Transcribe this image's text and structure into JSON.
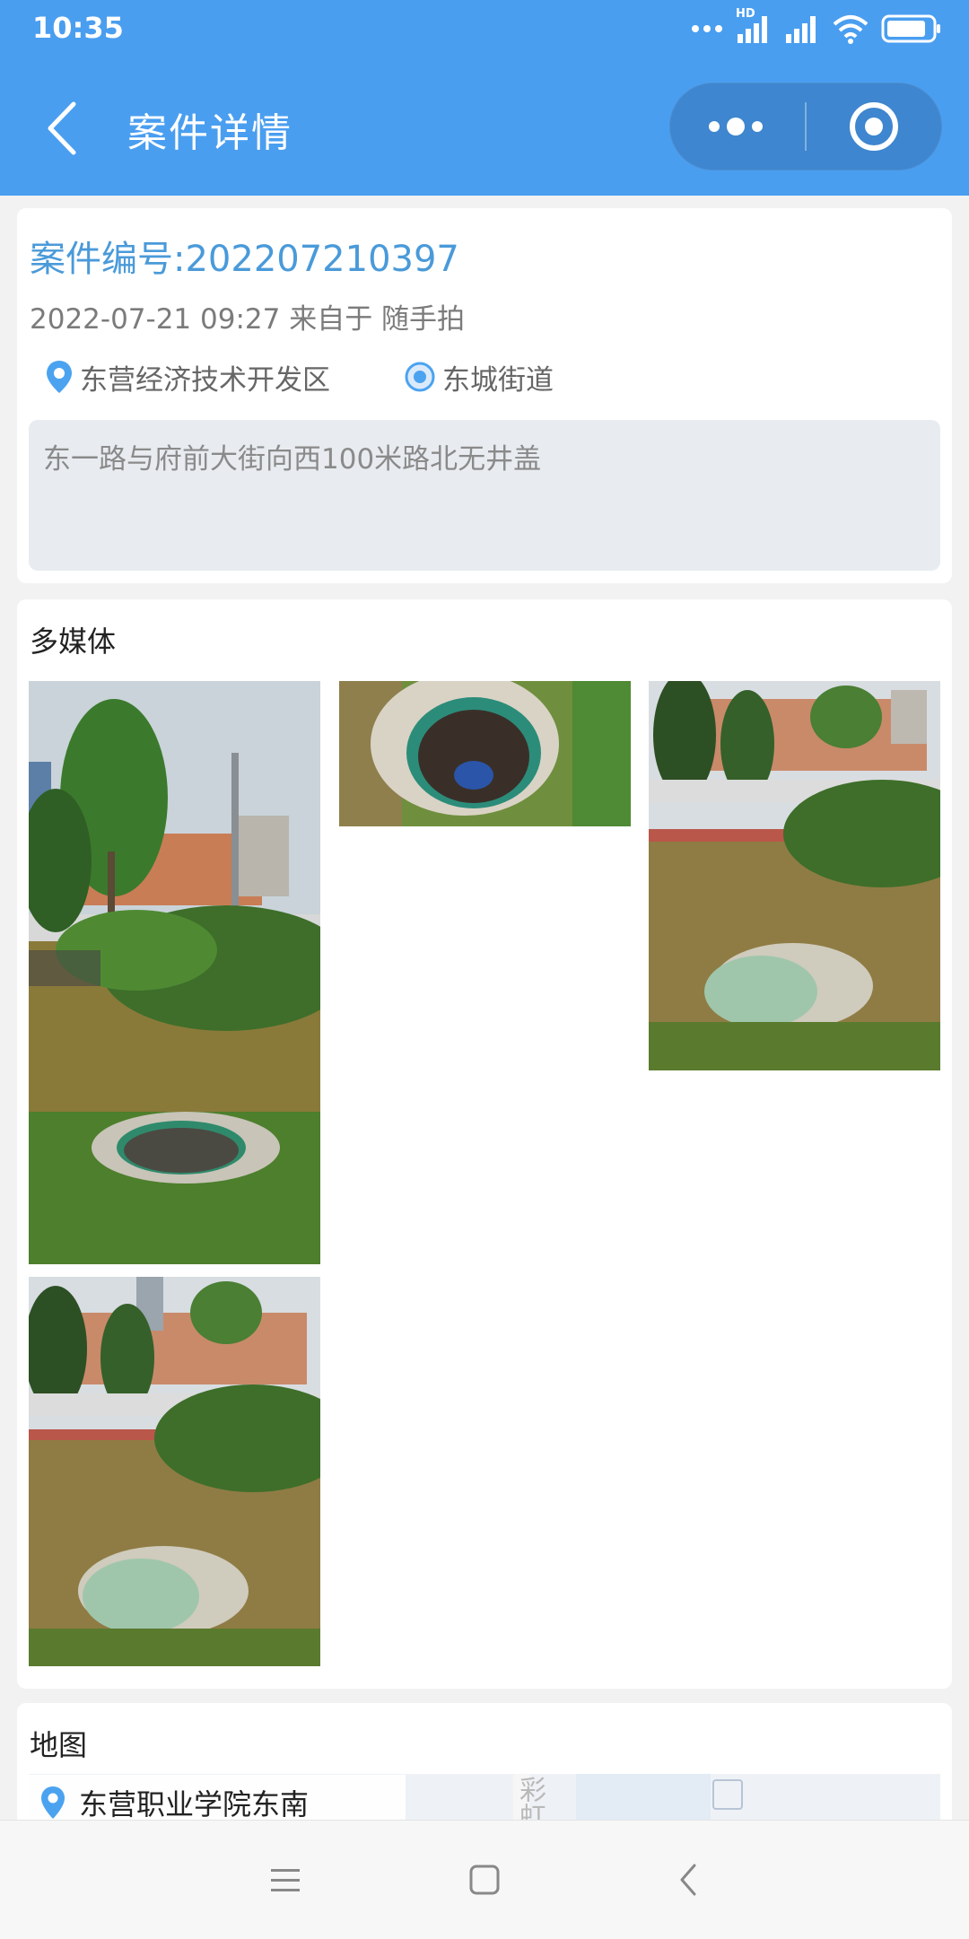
{
  "status_bar": {
    "time": "10:35",
    "icons": [
      "dots-icon",
      "hd-signal-icon",
      "signal-icon",
      "wifi-icon",
      "battery-icon"
    ],
    "hd_label": "HD"
  },
  "nav": {
    "title": "案件详情",
    "back_icon": "chevron-left-icon",
    "more_icon": "more-dots-icon",
    "close_icon": "target-circle-icon"
  },
  "case": {
    "number_label": "案件编号:202207210397",
    "meta": "2022-07-21 09:27 来自于 随手拍",
    "district": "东营经济技术开发区",
    "street": "东城街道",
    "description": "东一路与府前大街向西100米路北无井盖"
  },
  "media": {
    "title": "多媒体",
    "photos": [
      {
        "name": "open-manhole-wide"
      },
      {
        "name": "open-manhole-closeup"
      },
      {
        "name": "covered-manhole-wide"
      },
      {
        "name": "covered-manhole-wide-2"
      }
    ]
  },
  "map": {
    "title": "地图",
    "place": "东营职业学院东南",
    "map_label": "彩虹"
  },
  "system_nav": {
    "icons": [
      "menu-icon",
      "home-square-icon",
      "back-chevron-icon"
    ]
  },
  "colors": {
    "header_blue": "#4a9ef0",
    "capsule": "#3e86cf",
    "link_blue": "#4a9ad9",
    "pin_blue": "#4ba3f0"
  }
}
